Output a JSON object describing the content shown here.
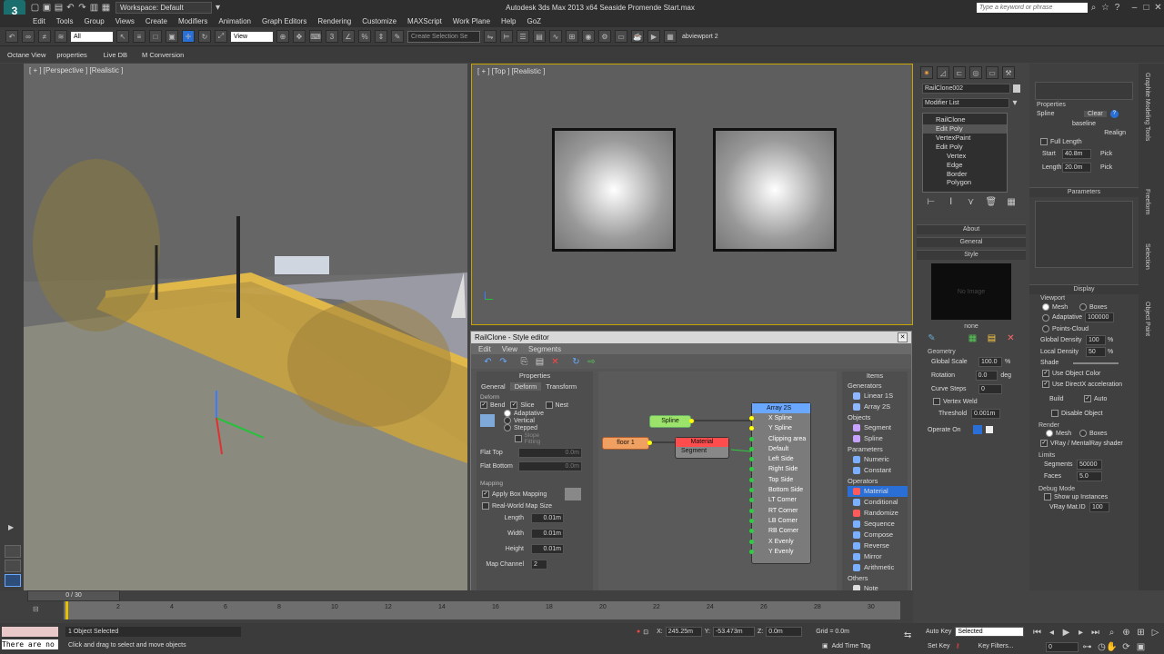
{
  "title_bar": {
    "workspace_label": "Workspace: Default",
    "window_title": "Autodesk 3ds Max  2013 x64     Seaside Promende Start.max",
    "search_placeholder": "Type a keyword or phrase"
  },
  "menu": [
    "Edit",
    "Tools",
    "Group",
    "Views",
    "Create",
    "Modifiers",
    "Animation",
    "Graph Editors",
    "Rendering",
    "Customize",
    "MAXScript",
    "Work Plane",
    "Help",
    "GoZ"
  ],
  "toolbar": {
    "selection_filter": "All",
    "ref_coord": "View",
    "selection_set": "Create Selection Se",
    "viewport_name": "abviewport 2"
  },
  "secondary_toolbar": [
    "Octane View",
    "properties",
    "Live DB",
    "M Conversion"
  ],
  "viewports": {
    "left_label": "[ + ] [Perspective ] [Realistic ]",
    "top_label": "[ + ] [Top ] [Realistic ]"
  },
  "command_panel": {
    "object_name": "RailClone002",
    "modifier_list": "Modifier List",
    "stack": [
      "RailClone",
      "Edit Poly",
      "VertexPaint",
      "Edit Poly",
      "Vertex",
      "Edge",
      "Border",
      "Polygon"
    ],
    "rollouts": [
      "About",
      "General",
      "Style"
    ],
    "no_image": "No Image",
    "style_name": "none",
    "geometry_label": "Geometry",
    "global_scale_label": "Global Scale",
    "global_scale": "100.0",
    "rotation_label": "Rotation",
    "rotation": "0.0",
    "curve_steps_label": "Curve Steps",
    "curve_steps": "0",
    "vertex_weld_label": "Vertex Weld",
    "threshold_label": "Threshold",
    "threshold": "0.001m",
    "operate_on_label": "Operate On"
  },
  "properties_panel": {
    "properties_head": "Properties",
    "spline_label": "Spline",
    "clear_label": "Clear",
    "baseline": "baseline",
    "realign": "Realign",
    "full_length": "Full Length",
    "start_label": "Start",
    "start_val": "40.8m",
    "length_label": "Length",
    "length_val": "20.0m",
    "pick": "Pick",
    "parameters_head": "Parameters",
    "display_head": "Display",
    "viewport_label": "Viewport",
    "mesh": "Mesh",
    "boxes": "Boxes",
    "adaptative": "Adaptative",
    "adaptative_val": "100000",
    "points_cloud": "Points-Cloud",
    "global_density_label": "Global Density",
    "global_density": "100",
    "local_density_label": "Local Density",
    "local_density": "50",
    "shade": "Shade",
    "use_object_color": "Use Object Color",
    "use_directx": "Use DirectX acceleration",
    "build": "Build",
    "auto": "Auto",
    "disable_object": "Disable Object",
    "render_head": "Render",
    "vray": "VRay / MentalRay shader",
    "limits_head": "Limits",
    "segments_label": "Segments",
    "segments": "50000",
    "faces_label": "Faces",
    "faces": "5.0",
    "debug_head": "Debug Mode",
    "show_up_instances": "Show up Instances",
    "vray_mat_label": "VRay Mat.ID",
    "vray_mat": "100"
  },
  "ribbon_tabs": [
    "Graphite Modeling Tools",
    "Freeform",
    "Selection",
    "Object Paint"
  ],
  "style_editor": {
    "title": "RailClone - Style editor",
    "menu": [
      "Edit",
      "View",
      "Segments"
    ],
    "properties_head": "Properties",
    "tabs": [
      "General",
      "Deform",
      "Transform"
    ],
    "deform_group": "Deform",
    "bend": "Bend",
    "slice": "Slice",
    "nest": "Nest",
    "adaptative": "Adaptative",
    "vertical": "Vertical",
    "stepped": "Stepped",
    "slope_fitting": "Slope Fitting",
    "flat_top": "Flat Top",
    "flat_bottom": "Flat Bottom",
    "flat_top_val": "0.0m",
    "flat_bottom_val": "0.0m",
    "mapping_group": "Mapping",
    "apply_box_mapping": "Apply Box Mapping",
    "real_world_map_size": "Real-World Map Size",
    "length_label": "Length",
    "width_label": "Width",
    "height_label": "Height",
    "length_val": "0.01m",
    "width_val": "0.01m",
    "height_val": "0.01m",
    "map_channel_label": "Map Channel",
    "map_channel": "2",
    "nodes": {
      "spline": "Spline",
      "floor": "floor 1",
      "material": "Material",
      "segment": "Segment",
      "array": "Array 2S",
      "array_inputs": [
        "X Spline",
        "Y Spline",
        "Clipping area",
        "Default",
        "Left Side",
        "Right Side",
        "Top Side",
        "Bottom Side",
        "LT Corner",
        "RT Corner",
        "LB Corner",
        "RB Corner",
        "X Evenly",
        "Y Evenly"
      ]
    },
    "items_head": "Items",
    "items": [
      {
        "group": "Generators",
        "entries": [
          {
            "label": "Linear 1S",
            "color": "#8fb7ff"
          },
          {
            "label": "Array 2S",
            "color": "#8fb7ff"
          }
        ]
      },
      {
        "group": "Objects",
        "entries": [
          {
            "label": "Segment",
            "color": "#c7a3ff"
          },
          {
            "label": "Spline",
            "color": "#c7a3ff"
          }
        ]
      },
      {
        "group": "Parameters",
        "entries": [
          {
            "label": "Numeric",
            "color": "#7ab0ff"
          },
          {
            "label": "Constant",
            "color": "#7ab0ff"
          }
        ]
      },
      {
        "group": "Operators",
        "entries": [
          {
            "label": "Material",
            "color": "#ff5b5b"
          },
          {
            "label": "Conditional",
            "color": "#7ab0ff"
          },
          {
            "label": "Randomize",
            "color": "#ff5b5b"
          },
          {
            "label": "Sequence",
            "color": "#7ab0ff"
          },
          {
            "label": "Compose",
            "color": "#7ab0ff"
          },
          {
            "label": "Reverse",
            "color": "#7ab0ff"
          },
          {
            "label": "Mirror",
            "color": "#7ab0ff"
          },
          {
            "label": "Arithmetic",
            "color": "#7ab0ff"
          }
        ]
      },
      {
        "group": "Others",
        "entries": [
          {
            "label": "Note",
            "color": "#dddddd"
          }
        ]
      }
    ],
    "selected_item": "Material"
  },
  "timeline": {
    "frame": "0 / 30",
    "ticks": [
      "2",
      "4",
      "6",
      "8",
      "10",
      "12",
      "14",
      "16",
      "18",
      "20",
      "22",
      "24",
      "26",
      "28",
      "30"
    ]
  },
  "status": {
    "maxscript": "There are no",
    "objects_selected": "1 Object Selected",
    "prompt": "Click and drag to select and move objects",
    "x_label": "X:",
    "x_val": "245.25m",
    "y_label": "Y:",
    "y_val": "-53.473m",
    "z_label": "Z:",
    "z_val": "0.0m",
    "grid": "Grid = 0.0m",
    "add_time_tag": "Add Time Tag",
    "auto_key": "Auto Key",
    "selected": "Selected",
    "set_key": "Set Key",
    "key_filters": "Key Filters...",
    "frame_field": "0"
  },
  "colors": {
    "accent_yellow": "#c8a400",
    "node_green": "#9be36a",
    "node_orange": "#f0a060",
    "node_red": "#ff4c4c",
    "node_blue": "#6aa8ff",
    "selected_blue": "#2a6fd6"
  }
}
